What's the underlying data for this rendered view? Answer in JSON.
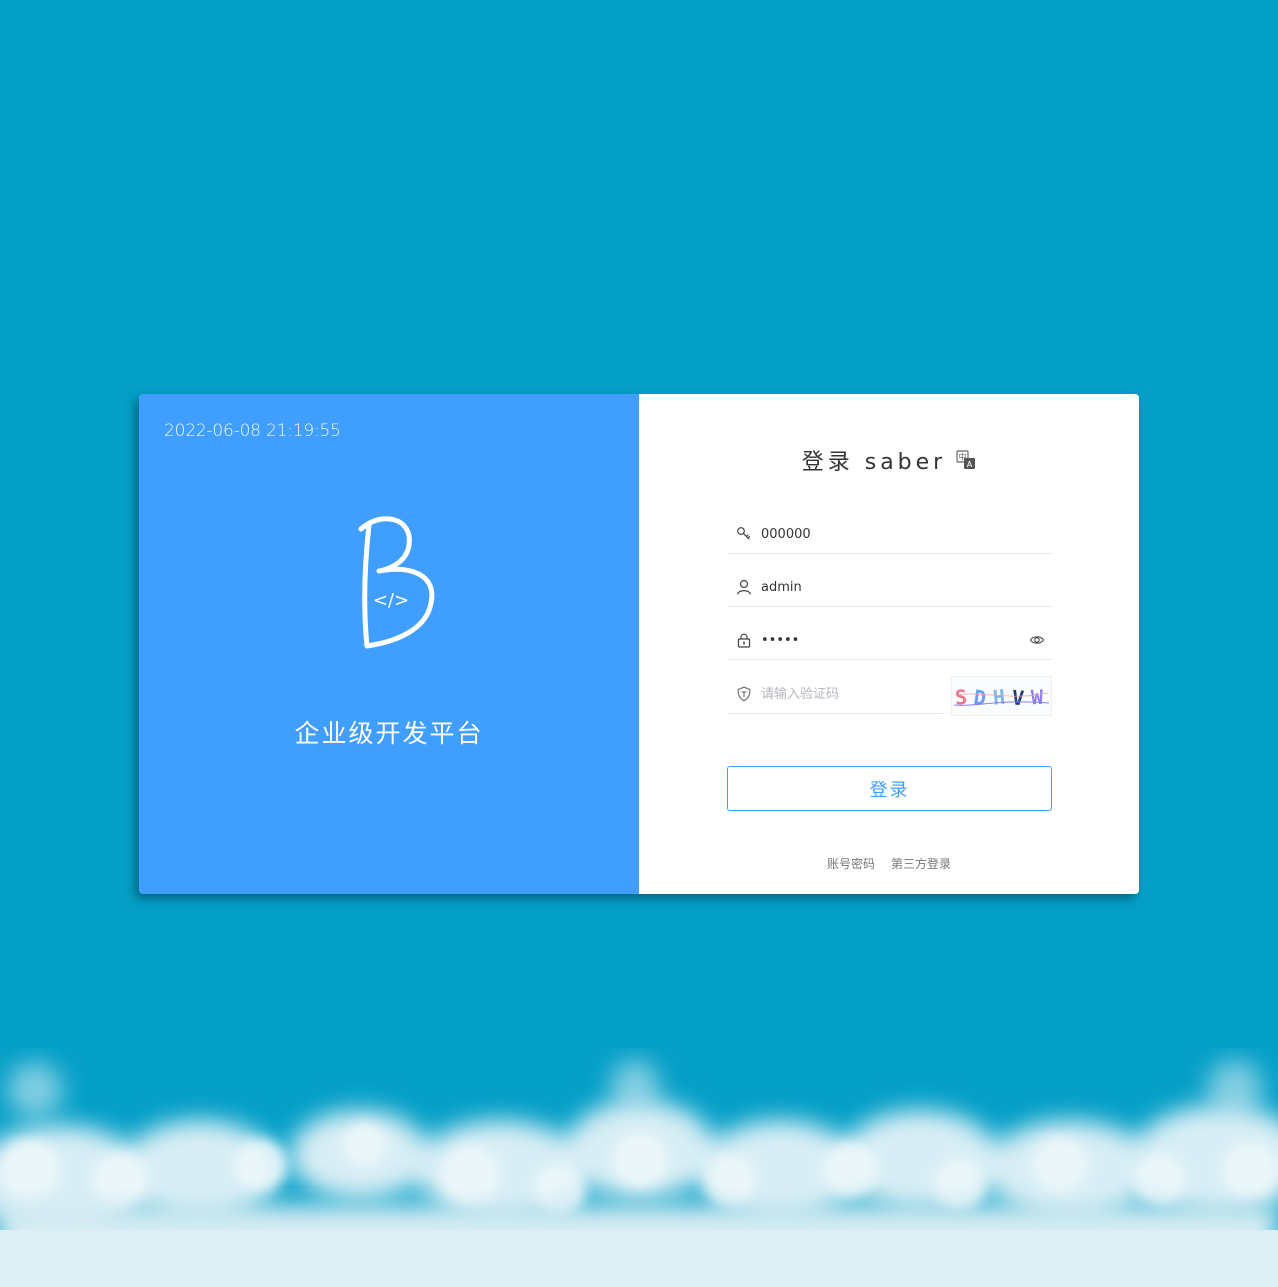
{
  "left": {
    "time": "2022-06-08 21:19:55",
    "slogan": "企业级开发平台",
    "logo_name": "b-code-logo"
  },
  "login": {
    "title": "登录 saber",
    "language_icon": "translate-icon",
    "tenant": {
      "value": "000000",
      "icon": "key-icon"
    },
    "username": {
      "value": "admin",
      "icon": "user-icon"
    },
    "password": {
      "value": "admin",
      "icon": "lock-icon",
      "suffix_icon": "eye-icon"
    },
    "captcha": {
      "placeholder": "请输入验证码",
      "icon": "shield-icon",
      "code": "SDHVW"
    },
    "submit_label": "登录",
    "links": [
      "账号密码",
      "第三方登录"
    ]
  },
  "colors": {
    "background": "#049fc7",
    "accent": "#409eff",
    "panel": "#ffffff"
  }
}
